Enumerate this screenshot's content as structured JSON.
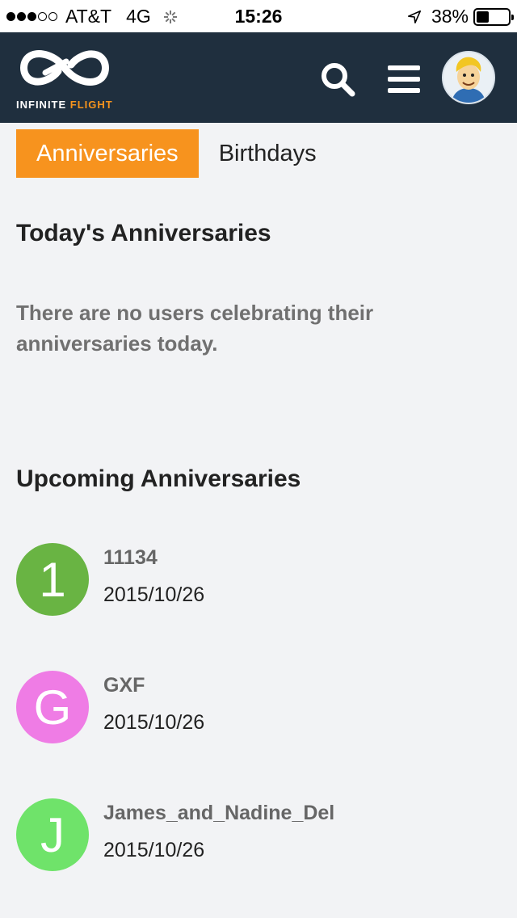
{
  "status_bar": {
    "carrier": "AT&T",
    "network": "4G",
    "time": "15:26",
    "battery": "38%",
    "signal_bars_filled": 3,
    "signal_bars_total": 5
  },
  "header": {
    "logo_text_main": "INFINITE",
    "logo_text_accent": "FLIGHT",
    "colors": {
      "background": "#1f2f3e",
      "accent": "#f7941d"
    }
  },
  "tabs": [
    {
      "label": "Anniversaries",
      "active": true
    },
    {
      "label": "Birthdays",
      "active": false
    }
  ],
  "today": {
    "title": "Today's Anniversaries",
    "empty_message": "There are no users celebrating their anniversaries today."
  },
  "upcoming": {
    "title": "Upcoming Anniversaries",
    "users": [
      {
        "initial": "1",
        "name": "11134",
        "date": "2015/10/26",
        "color": "#69b443"
      },
      {
        "initial": "G",
        "name": "GXF",
        "date": "2015/10/26",
        "color": "#ef7ce5"
      },
      {
        "initial": "J",
        "name": "James_and_Nadine_Del",
        "date": "2015/10/26",
        "color": "#6fe36a"
      }
    ]
  }
}
